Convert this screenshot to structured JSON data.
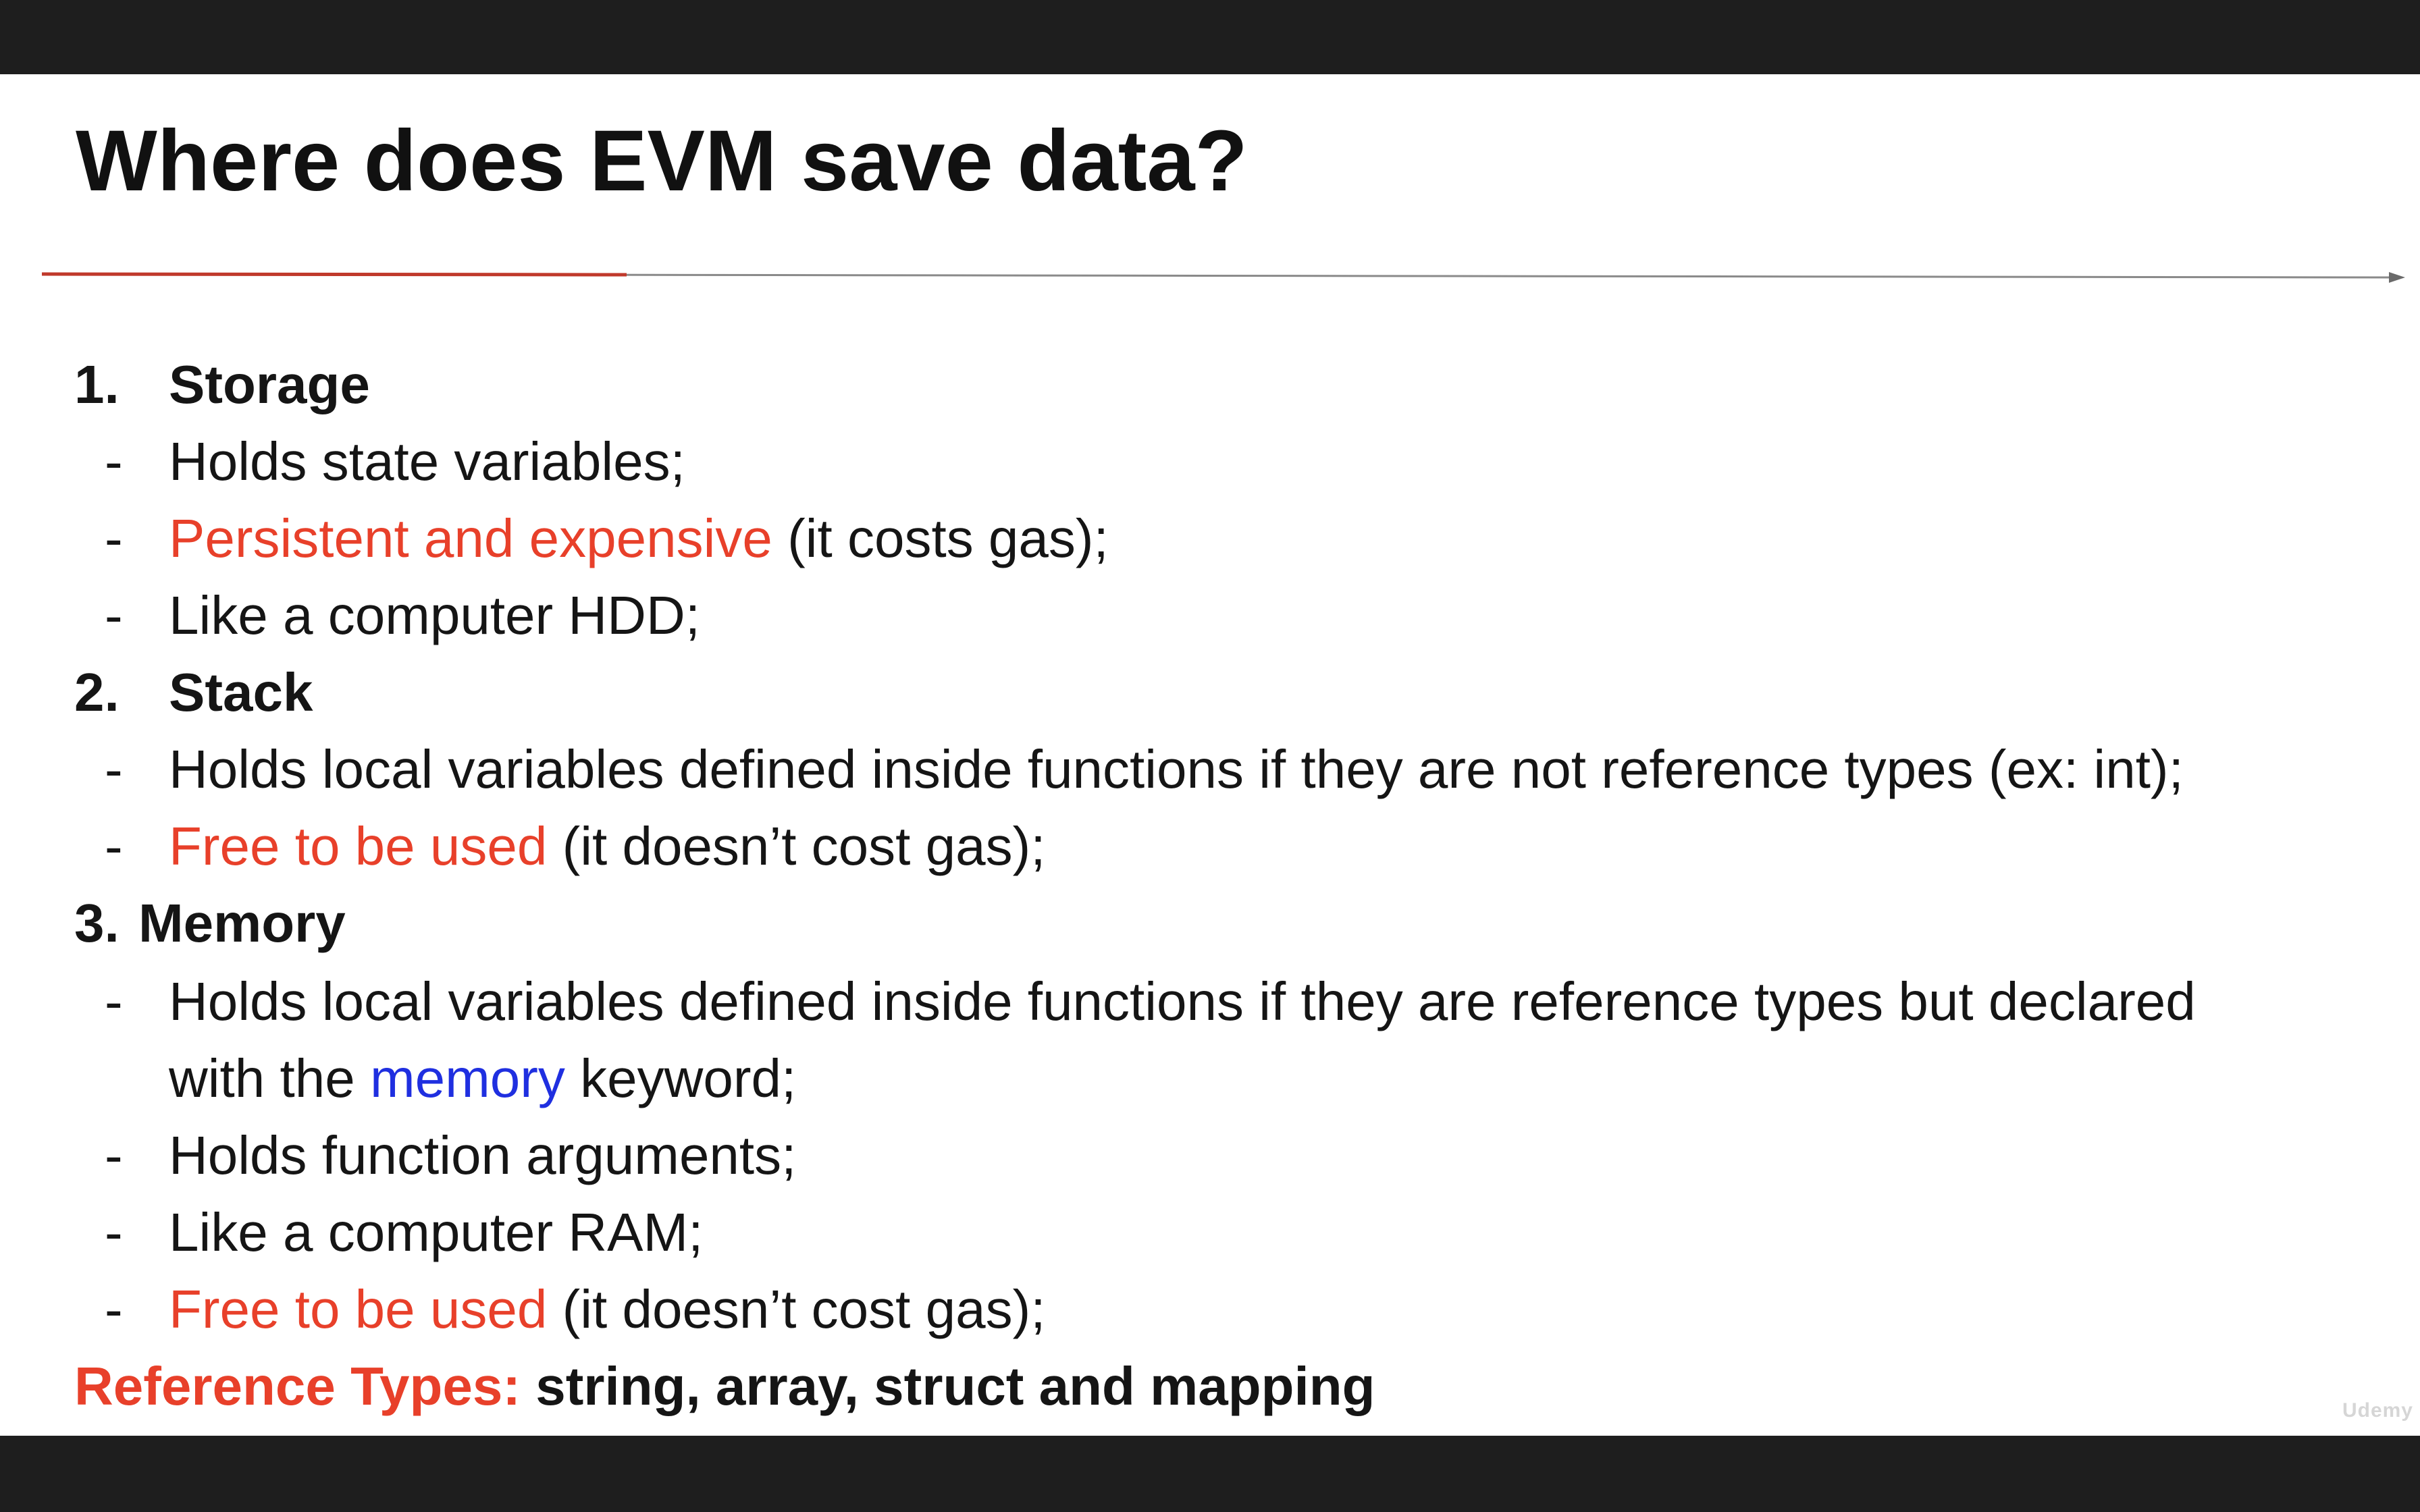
{
  "slide": {
    "title": "Where does EVM save data?",
    "sections": [
      {
        "number": "1.",
        "heading": "Storage",
        "bullets": [
          {
            "dash": "-",
            "highlight": "",
            "text": "Holds state variables;"
          },
          {
            "dash": "-",
            "highlight": "Persistent and expensive",
            "text": " (it costs gas);"
          },
          {
            "dash": "-",
            "highlight": "",
            "text": "Like a computer HDD;"
          }
        ]
      },
      {
        "number": "2.",
        "heading": "Stack",
        "bullets": [
          {
            "dash": "-",
            "highlight": "",
            "text": "Holds local variables defined inside functions if they are not reference types (ex: int);"
          },
          {
            "dash": "-",
            "highlight": "Free to be used",
            "text": " (it doesn’t cost gas);"
          }
        ]
      },
      {
        "number": "3.",
        "heading": "Memory",
        "bullets": [
          {
            "dash": "-",
            "text_line1": "Holds local variables defined inside functions if they are reference types but declared",
            "line2_pre": "with the ",
            "line2_keyword": "memory",
            "line2_post": " keyword;"
          },
          {
            "dash": "-",
            "highlight": "",
            "text": "Holds function arguments;"
          },
          {
            "dash": "-",
            "highlight": "",
            "text": "Like a computer RAM;"
          },
          {
            "dash": "-",
            "highlight": "Free to be used",
            "text": " (it doesn’t cost gas);"
          }
        ]
      }
    ],
    "reference_types": {
      "label": "Reference Types:",
      "value": " string, array, struct and mapping"
    },
    "watermark": "Udemy"
  },
  "colors": {
    "highlight_red": "#e8402a",
    "keyword_blue": "#1f2fe0",
    "divider_red": "#c0392b",
    "divider_gray": "#8a8a8a",
    "frame_bg": "#1e1e1e"
  }
}
